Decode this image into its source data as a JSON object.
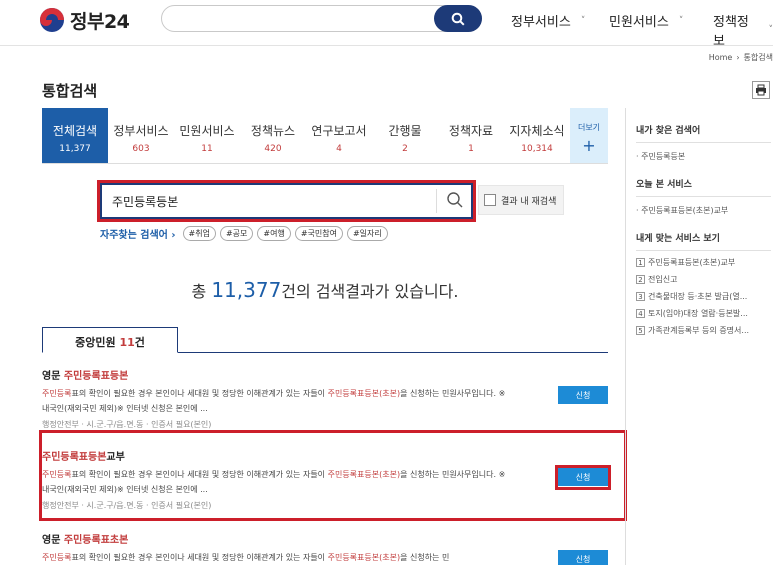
{
  "header": {
    "logo_text": "정부24",
    "nav": [
      "정부서비스",
      "민원서비스",
      "정책정보"
    ]
  },
  "breadcrumb": {
    "home": "Home",
    "current": "통합검색"
  },
  "page_title": "통합검색",
  "tabs": [
    {
      "label": "전체검색",
      "count": "11,377",
      "active": true
    },
    {
      "label": "정부서비스",
      "count": "603"
    },
    {
      "label": "민원서비스",
      "count": "11"
    },
    {
      "label": "정책뉴스",
      "count": "420"
    },
    {
      "label": "연구보고서",
      "count": "4"
    },
    {
      "label": "간행물",
      "count": "2"
    },
    {
      "label": "정책자료",
      "count": "1"
    },
    {
      "label": "지자체소식",
      "count": "10,314"
    }
  ],
  "more_tab": {
    "label": "더보기",
    "plus": "+"
  },
  "search": {
    "value": "주민등록등본",
    "recheck_label": "결과 내 재검색"
  },
  "popular": {
    "label": "자주찾는 검색어",
    "terms": [
      "#취업",
      "#공모",
      "#여행",
      "#국민참여",
      "#일자리"
    ]
  },
  "summary": {
    "prefix": "총 ",
    "count": "11,377",
    "suffix": "건의 검색결과가 있습니다."
  },
  "section_tab": {
    "label": "중앙민원 ",
    "count": "11",
    "unit": "건"
  },
  "results": [
    {
      "title_prefix": "영문 ",
      "title_hl": "주민등록표등본",
      "title_suffix": "",
      "desc_hl1": "주민등록",
      "desc_1": "표의 확인이 필요한 경우 본인이나 세대원 및 정당한 이해관계가 있는 자들이 ",
      "desc_hl2": "주민등록표등본(초본)",
      "desc_2": "을 신청하는 민원사무입니다. ※ 내국인(재외국민 제외)※ 인터넷 신청은 본인에 ...",
      "meta": "행정안전부 · 시.군.구/읍.면.동 · 인증서 필요(본인)",
      "apply": "신청"
    },
    {
      "title_prefix": "",
      "title_hl": "주민등록표등본",
      "title_suffix": "교부",
      "desc_hl1": "주민등록",
      "desc_1": "표의 확인이 필요한 경우 본인이나 세대원 및 정당한 이해관계가 있는 자들이 ",
      "desc_hl2": "주민등록표등본(초본)",
      "desc_2": "을 신청하는 민원사무입니다. ※ 내국인(재외국민 제외)※ 인터넷 신청은 본인에 ...",
      "meta": "행정안전부 · 시.군.구/읍.면.동 · 인증서 필요(본인)",
      "apply": "신청"
    },
    {
      "title_prefix": "영문 ",
      "title_hl": "주민등록표초본",
      "title_suffix": "",
      "desc_hl1": "주민등록",
      "desc_1": "표의 확인이 필요한 경우 본인이나 세대원 및 정당한 이해관계가 있는 자들이 ",
      "desc_hl2": "주민등록표등본(초본)",
      "desc_2": "을 신청하는 민",
      "meta": "",
      "apply": "신청"
    }
  ],
  "sidebar": {
    "my_search_title": "내가 찾은 검색어",
    "my_search": [
      "주민등록등본"
    ],
    "today_title": "오늘 본 서비스",
    "today": [
      "주민등록표등본(초본)교부"
    ],
    "fit_title": "내게 맞는 서비스 보기",
    "fit": [
      "주민등록표등본(초본)교부",
      "전입신고",
      "건축물대장 등·초본 발급(열...",
      "토지(임야)대장 열람·등본발...",
      "가족관계등록부 등의 증명서..."
    ]
  },
  "colors": {
    "brand_navy": "#1d3a78",
    "tab_active": "#1d5ea8",
    "highlight_red": "#c23c3c",
    "apply_blue": "#1d8bd6",
    "annotation_red": "#cc1f2a"
  }
}
